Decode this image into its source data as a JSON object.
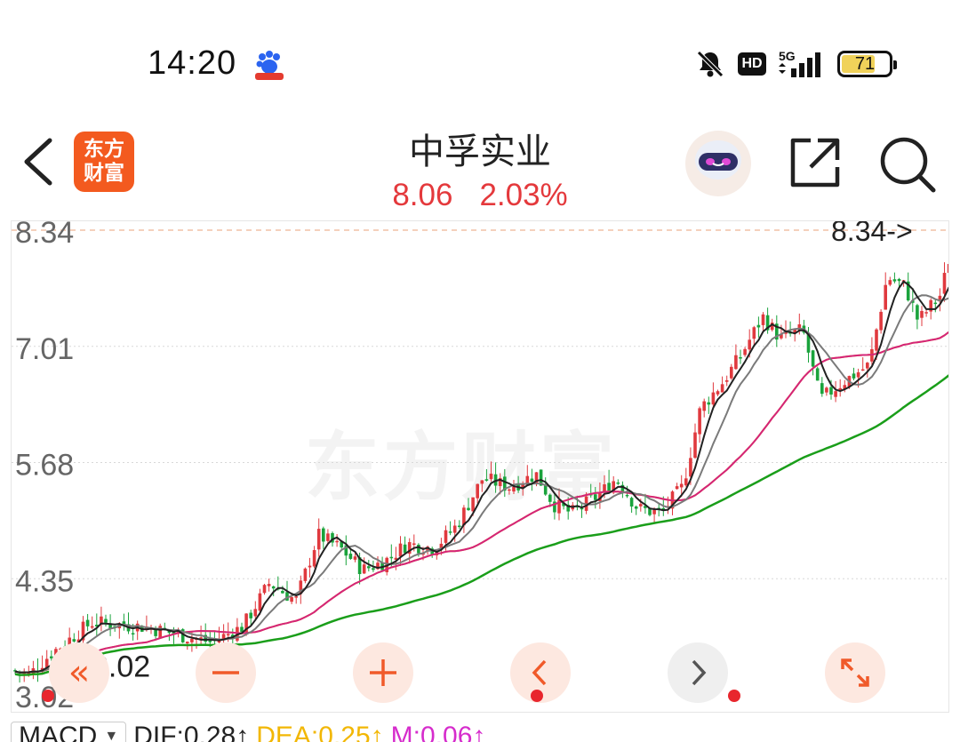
{
  "status_bar": {
    "time": "14:20",
    "network": "5G",
    "hd_label": "HD",
    "battery_level": "71",
    "icons": [
      "baidu-app-icon",
      "bell-muted-icon",
      "hd-icon",
      "signal-5g-icon",
      "battery-icon"
    ]
  },
  "header": {
    "app_logo_line1": "东方",
    "app_logo_line2": "财富",
    "stock_name": "中孚实业",
    "price": "8.06",
    "change_pct": "2.03%",
    "price_color": "#e4393c"
  },
  "chart": {
    "y_labels": [
      "8.34",
      "7.01",
      "5.68",
      "4.35",
      "3.02"
    ],
    "high_marker": "8.34->",
    "low_marker": "3.02",
    "watermark": "东方财富",
    "colors": {
      "up": "#e0393e",
      "down": "#1aa33c",
      "ma5": "#222222",
      "ma10": "#7a7a7a",
      "ma20": "#f2b705",
      "ma30": "#d4237a",
      "ma60": "#1a9e1a"
    }
  },
  "controls": {
    "scroll_left_label": "«",
    "zoom_out_label": "−",
    "zoom_in_label": "+",
    "prev_label": "‹",
    "next_label": "›",
    "fullscreen_label": "expand"
  },
  "indicator": {
    "name": "MACD",
    "dif": "DIF:0.28↑",
    "dea": "DEA:0.25↑",
    "m": "M:0.06↑",
    "dif_color": "#222222",
    "dea_color": "#f2b705",
    "m_color": "#d62ccc"
  }
}
